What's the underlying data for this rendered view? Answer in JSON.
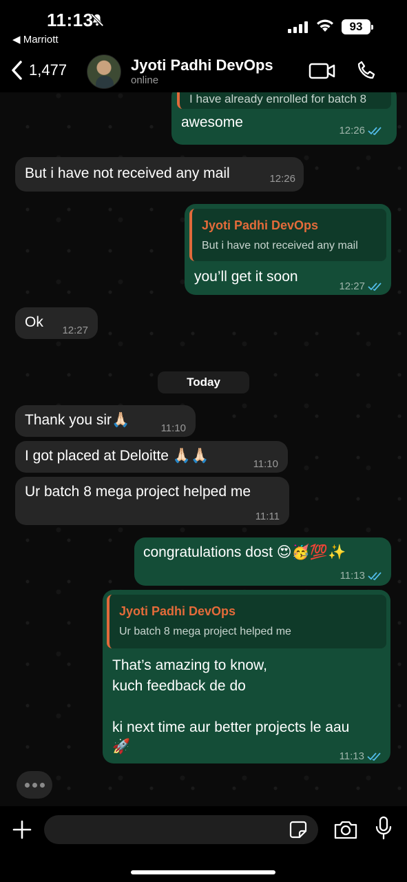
{
  "status_bar": {
    "time": "11:13",
    "back_app": "◀ Marriott",
    "battery": "93"
  },
  "header": {
    "back_count": "1,477",
    "contact_name": "Jyoti Padhi DevOps",
    "contact_status": "online"
  },
  "messages": [
    {
      "id": "m1",
      "type": "out",
      "quote_text_partial": "I have already enrolled for batch 8",
      "text": "awesome",
      "time": "12:26"
    },
    {
      "id": "m2",
      "type": "in",
      "text": "But i have not received any mail",
      "time": "12:26"
    },
    {
      "id": "m3",
      "type": "out",
      "quote_name": "Jyoti Padhi DevOps",
      "quote_text": "But i have not received any mail",
      "text": "you’ll get it soon",
      "time": "12:27"
    },
    {
      "id": "m4",
      "type": "in",
      "text": "Ok",
      "time": "12:27"
    },
    {
      "id": "m5",
      "type": "in",
      "text": "Thank you sir🙏🏻",
      "time": "11:10"
    },
    {
      "id": "m6",
      "type": "in",
      "text": "I got placed at Deloitte 🙏🏻🙏🏻",
      "time": "11:10"
    },
    {
      "id": "m7",
      "type": "in",
      "text": "Ur batch 8 mega project helped me",
      "time": "11:11"
    },
    {
      "id": "m8",
      "type": "out",
      "text": "congratulations dost 😍🥳💯✨",
      "time": "11:13"
    },
    {
      "id": "m9",
      "type": "out",
      "quote_name": "Jyoti Padhi DevOps",
      "quote_text": "Ur batch 8 mega project helped me",
      "text_line1": "That’s amazing to know,",
      "text_line2": "kuch feedback de do",
      "text_line3": "ki next time aur better projects le aau",
      "text_line4": "🚀",
      "time": "11:13"
    }
  ],
  "date_divider": "Today",
  "colors": {
    "outgoing_bubble": "#144d37",
    "incoming_bubble": "#262626",
    "quote_accent": "#e06a3b",
    "read_ticks": "#53bdeb"
  },
  "icons": [
    "bell-slash-icon",
    "signal-icon",
    "wifi-icon",
    "back-chevron-icon",
    "video-call-icon",
    "phone-icon",
    "plus-icon",
    "sticker-icon",
    "camera-icon",
    "mic-icon",
    "double-tick-icon"
  ]
}
